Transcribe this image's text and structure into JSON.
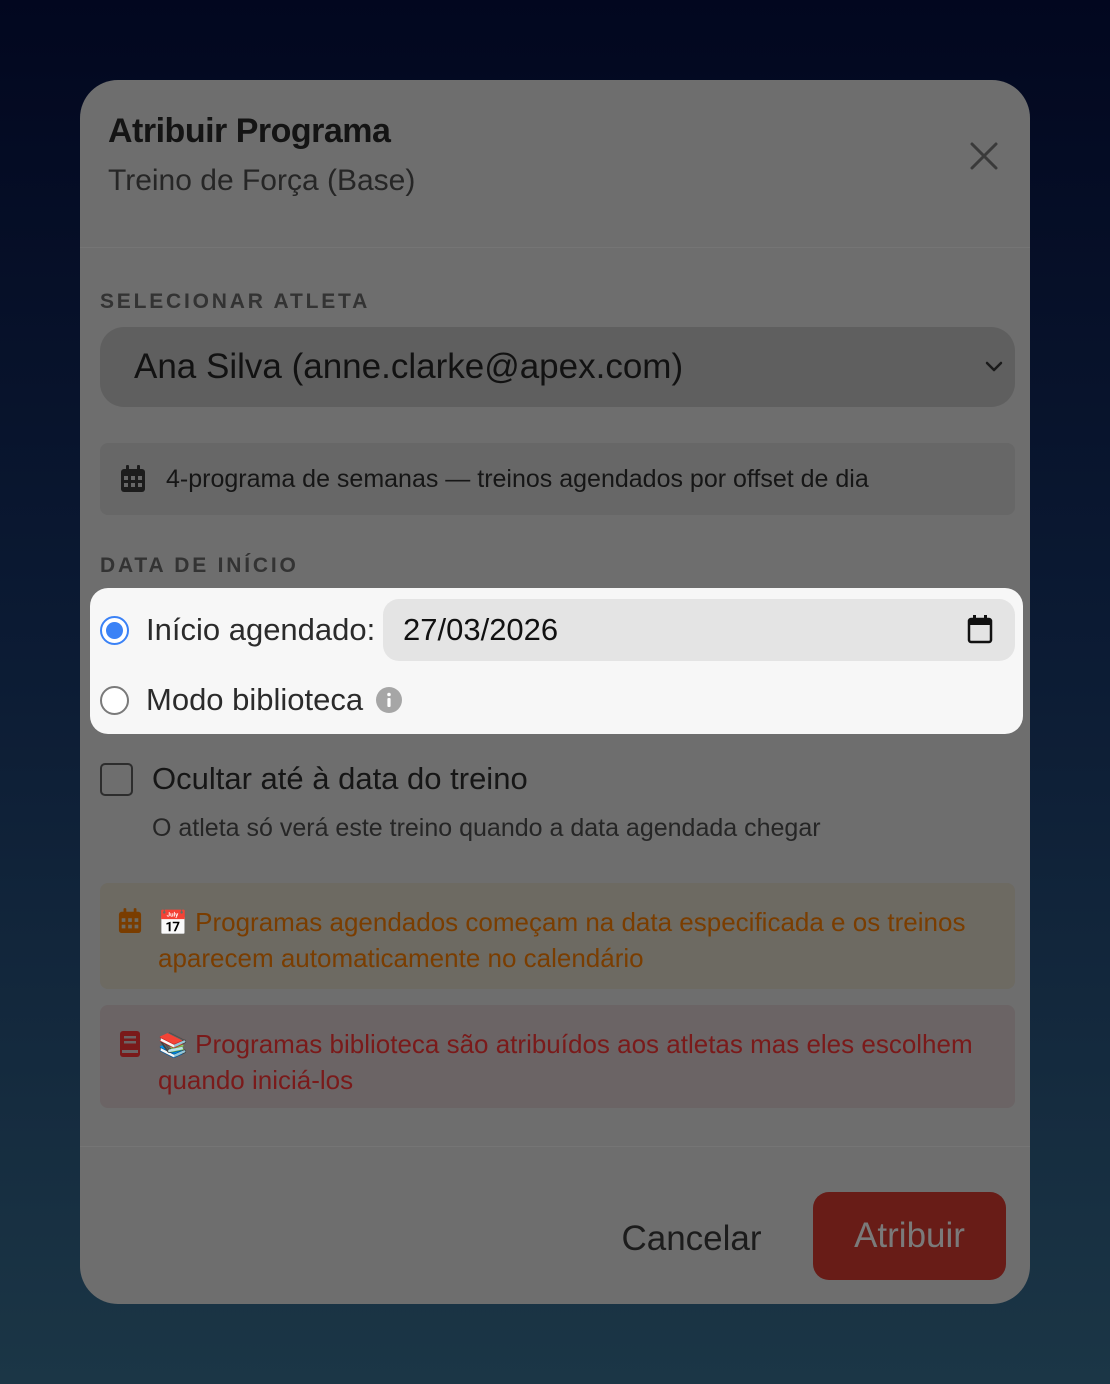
{
  "modal": {
    "title": "Atribuir Programa",
    "subtitle": "Treino de Força (Base)",
    "close_icon": "close-icon"
  },
  "athlete": {
    "label": "SELECIONAR ATLETA",
    "selected": "Ana Silva (anne.clarke@apex.com)"
  },
  "program_info": {
    "icon": "calendar-icon",
    "text": "4-programa de semanas — treinos agendados por offset de dia"
  },
  "start_date": {
    "label": "DATA DE INÍCIO",
    "scheduled_label": "Início agendado:",
    "scheduled_checked": true,
    "date_value": "27/03/2026",
    "library_label": "Modo biblioteca",
    "library_checked": false
  },
  "hide_option": {
    "label": "Ocultar até à data do treino",
    "help": "O atleta só verá este treino quando a data agendada chegar",
    "checked": false
  },
  "alerts": {
    "scheduled_emoji": "📅",
    "scheduled": "Programas agendados começam na data especificada e os treinos aparecem automaticamente no calendário",
    "library_emoji": "📚",
    "library": "Programas biblioteca são atribuídos aos atletas mas eles escolhem quando iniciá-los"
  },
  "footer": {
    "cancel": "Cancelar",
    "assign": "Atribuir"
  },
  "colors": {
    "accent": "#3b82f6",
    "primary_button": "#681c17",
    "warning_text": "#7a3d00",
    "danger_text": "#7a1a1a"
  }
}
